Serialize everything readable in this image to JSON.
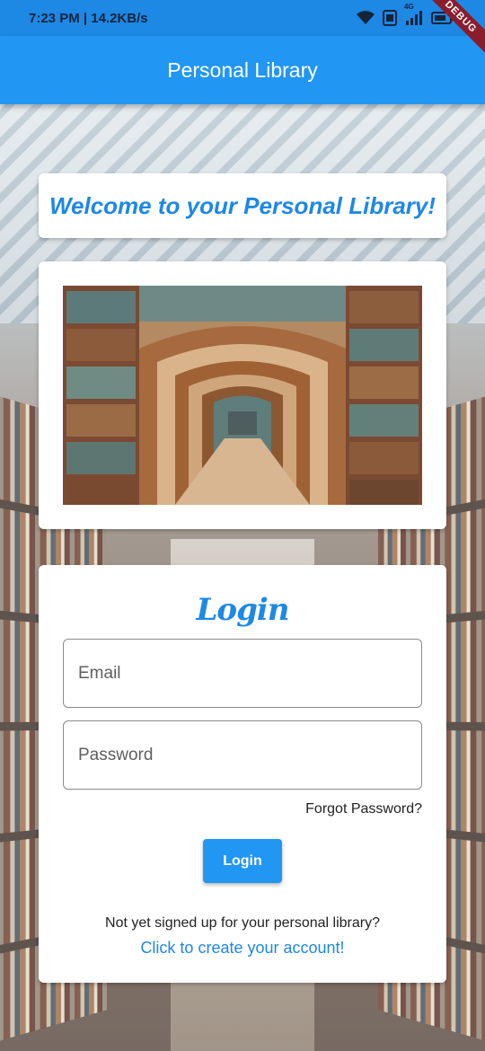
{
  "status_bar": {
    "time_speed": "7:23 PM | 14.2KB/s",
    "network": "4G",
    "debug_banner": "DEBUG"
  },
  "app_bar": {
    "title": "Personal Library"
  },
  "welcome": {
    "text": "Welcome to your Personal Library!"
  },
  "hero_image": {
    "description_icon": "library-arches-photo"
  },
  "login": {
    "title": "Login",
    "email_placeholder": "Email",
    "password_placeholder": "Password",
    "forgot_password": "Forgot Password?",
    "button_label": "Login",
    "signup_prompt": "Not yet signed up for your personal library?",
    "signup_link": "Click to create your account!"
  },
  "colors": {
    "primary": "#2196f3",
    "primary_dark": "#1e88e5",
    "status_bar": "#1e88e5",
    "card": "#ffffff",
    "debug_ribbon": "#8b1c2c"
  }
}
